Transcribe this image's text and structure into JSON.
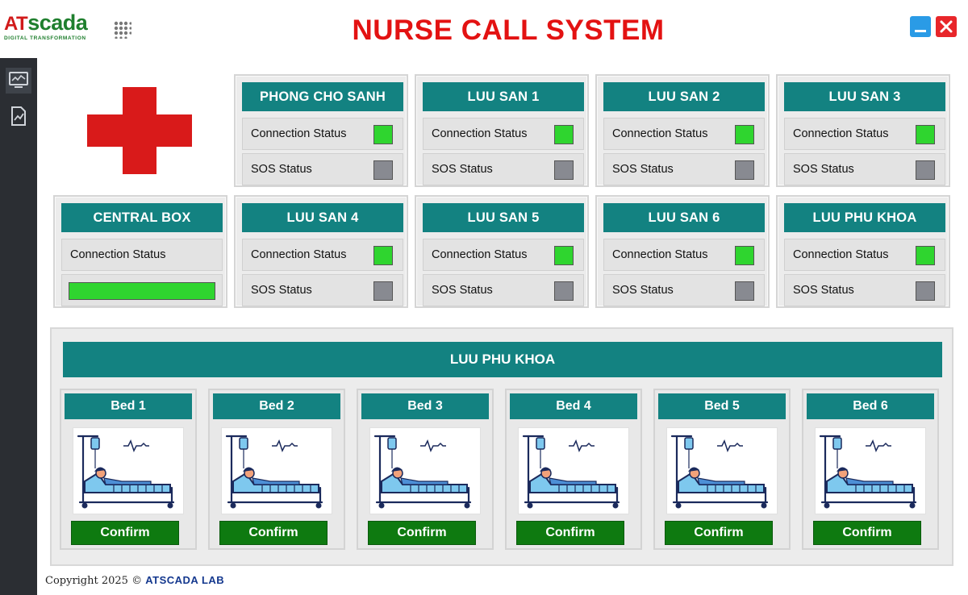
{
  "app": {
    "logo_prefix": "AT",
    "logo_main": "scada",
    "logo_tagline": "DIGITAL TRANSFORMATION",
    "title": "NURSE CALL SYSTEM",
    "title_color": "#e31212"
  },
  "window_controls": {
    "minimize_icon": "minimize-icon",
    "close_icon": "close-icon"
  },
  "sidebar": {
    "items": [
      {
        "icon": "monitor-icon",
        "active": true
      },
      {
        "icon": "chart-report-icon",
        "active": false
      }
    ]
  },
  "colors": {
    "teal_header": "#138281",
    "status_green": "#2fd52f",
    "status_grey": "#888a91",
    "confirm_green": "#0e7a10",
    "cross_red": "#d91a1a"
  },
  "rooms": [
    {
      "name": "PHONG CHO SANH",
      "connection_label": "Connection Status",
      "sos_label": "SOS Status",
      "connection_status": "online",
      "sos_status": "inactive"
    },
    {
      "name": "LUU SAN 1",
      "connection_label": "Connection Status",
      "sos_label": "SOS Status",
      "connection_status": "online",
      "sos_status": "inactive"
    },
    {
      "name": "LUU SAN 2",
      "connection_label": "Connection Status",
      "sos_label": "SOS Status",
      "connection_status": "online",
      "sos_status": "inactive"
    },
    {
      "name": "LUU SAN 3",
      "connection_label": "Connection Status",
      "sos_label": "SOS Status",
      "connection_status": "online",
      "sos_status": "inactive"
    },
    {
      "name": "LUU SAN 4",
      "connection_label": "Connection Status",
      "sos_label": "SOS Status",
      "connection_status": "online",
      "sos_status": "inactive"
    },
    {
      "name": "LUU SAN 5",
      "connection_label": "Connection Status",
      "sos_label": "SOS Status",
      "connection_status": "online",
      "sos_status": "inactive"
    },
    {
      "name": "LUU SAN 6",
      "connection_label": "Connection Status",
      "sos_label": "SOS Status",
      "connection_status": "online",
      "sos_status": "inactive"
    },
    {
      "name": "LUU PHU KHOA",
      "connection_label": "Connection Status",
      "sos_label": "SOS Status",
      "connection_status": "online",
      "sos_status": "inactive"
    }
  ],
  "central_box": {
    "name": "CENTRAL BOX",
    "connection_label": "Connection Status",
    "connection_status": "online",
    "connection_level": 1.0
  },
  "beds_section": {
    "title": "LUU PHU KHOA",
    "beds": [
      {
        "name": "Bed 1",
        "button": "Confirm",
        "image": "patient-bed-icon"
      },
      {
        "name": "Bed 2",
        "button": "Confirm",
        "image": "patient-bed-icon"
      },
      {
        "name": "Bed 3",
        "button": "Confirm",
        "image": "patient-bed-icon"
      },
      {
        "name": "Bed 4",
        "button": "Confirm",
        "image": "patient-bed-icon"
      },
      {
        "name": "Bed 5",
        "button": "Confirm",
        "image": "patient-bed-icon"
      },
      {
        "name": "Bed 6",
        "button": "Confirm",
        "image": "patient-bed-icon"
      }
    ]
  },
  "footer": {
    "copyright": "Copyright 2025 ©",
    "company": "ATSCADA LAB"
  }
}
